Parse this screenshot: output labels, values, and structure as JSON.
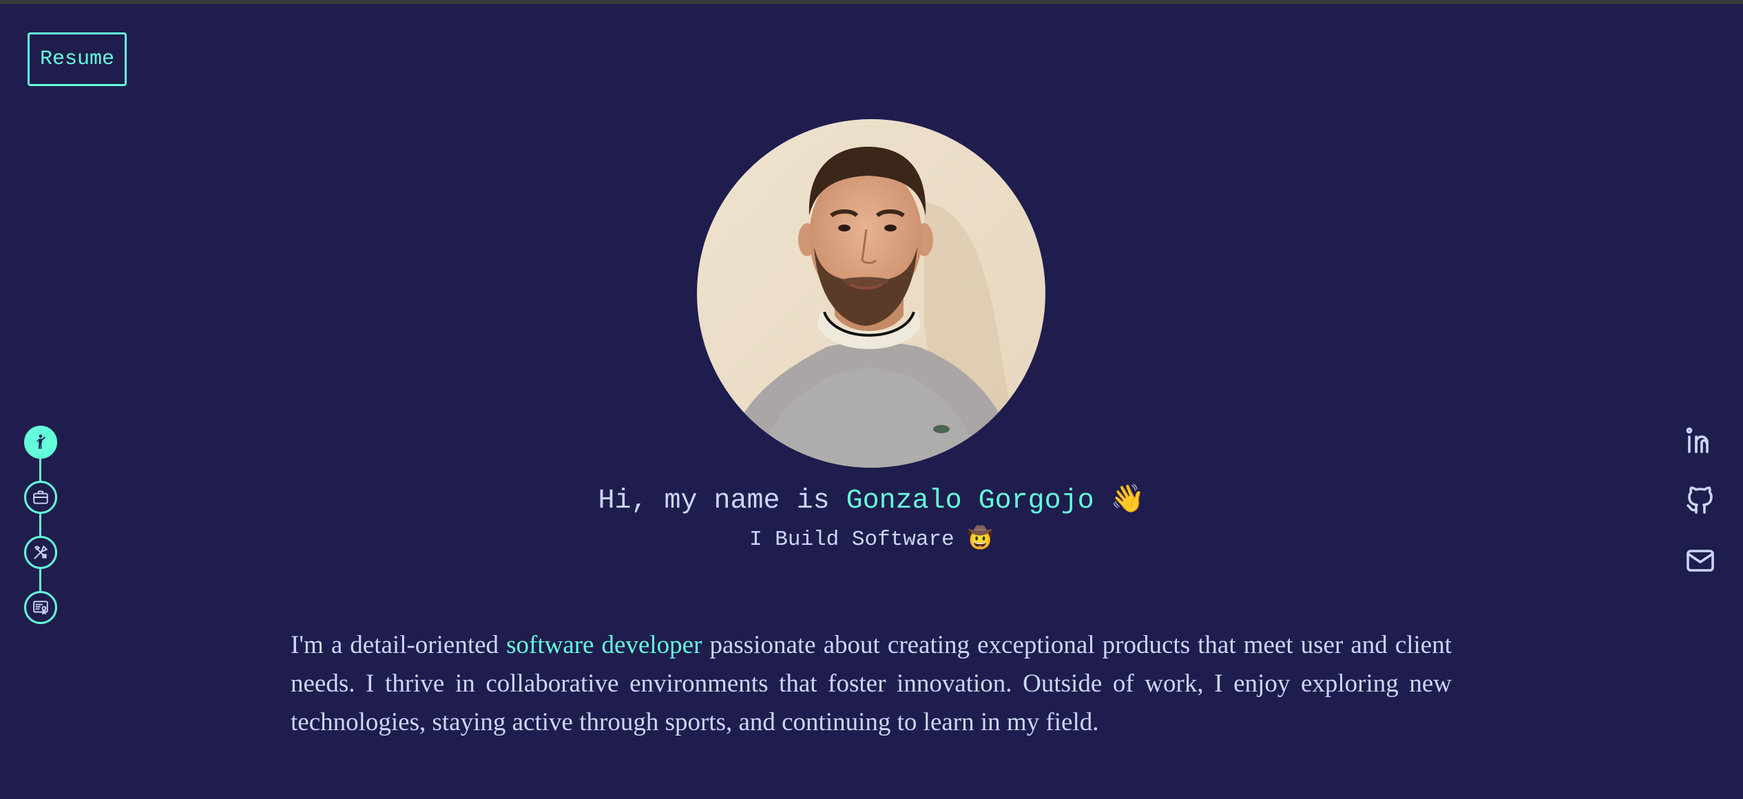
{
  "resume_button": {
    "label": "Resume"
  },
  "section_nav": {
    "items": [
      {
        "icon": "person-waving-icon",
        "active": true
      },
      {
        "icon": "briefcase-icon",
        "active": false
      },
      {
        "icon": "tools-icon",
        "active": false
      },
      {
        "icon": "certificate-icon",
        "active": false
      }
    ]
  },
  "social": {
    "items": [
      {
        "icon": "linkedin-icon"
      },
      {
        "icon": "github-icon"
      },
      {
        "icon": "mail-icon"
      }
    ]
  },
  "hero": {
    "greeting": "Hi, my name is ",
    "name": "Gonzalo Gorgojo",
    "greeting_emoji": "👋",
    "tagline": "I Build Software",
    "tagline_emoji": "🤠"
  },
  "bio": {
    "before_highlight": "I'm a detail-oriented ",
    "highlight": "software developer",
    "after_highlight": " passionate about creating exceptional products that meet user and client needs. I thrive in collaborative environments that foster innovation. Outside of work, I enjoy exploring new technologies, staying active through sports, and continuing to learn in my field."
  },
  "colors": {
    "background": "#1f1d4e",
    "accent": "#64ffda",
    "text": "#ccd6f6"
  }
}
